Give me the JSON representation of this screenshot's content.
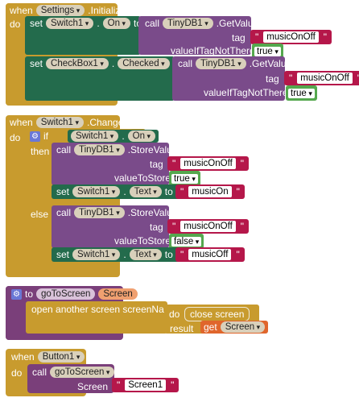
{
  "block1": {
    "when": "when",
    "component": "Settings",
    "event": ".Initialize",
    "do": "do",
    "set1": {
      "set": "set",
      "component": "Switch1",
      "dot": ".",
      "prop": "On",
      "to": "to",
      "call": "call",
      "db": "TinyDB1",
      "method": ".GetValue",
      "tag": "tag",
      "tag_value": "musicOnOff",
      "vitn": "valueIfTagNotThere",
      "default": "true"
    },
    "set2": {
      "set": "set",
      "component": "CheckBox1",
      "dot": ".",
      "prop": "Checked",
      "to": "to",
      "call": "call",
      "db": "TinyDB1",
      "method": ".GetValue",
      "tag": "tag",
      "tag_value": "musicOnOff",
      "vitn": "valueIfTagNotThere",
      "default": "true"
    }
  },
  "block2": {
    "when": "when",
    "component": "Switch1",
    "event": ".Changed",
    "do": "do",
    "if": "if",
    "cond_component": "Switch1",
    "cond_dot": ".",
    "cond_prop": "On",
    "then": "then",
    "else": "else",
    "then_call": {
      "call": "call",
      "db": "TinyDB1",
      "method": ".StoreValue",
      "tag": "tag",
      "tag_value": "musicOnOff",
      "vts": "valueToStore",
      "value": "true"
    },
    "then_set": {
      "set": "set",
      "component": "Switch1",
      "dot": ".",
      "prop": "Text",
      "to": "to",
      "value": "musicOn"
    },
    "else_call": {
      "call": "call",
      "db": "TinyDB1",
      "method": ".StoreValue",
      "tag": "tag",
      "tag_value": "musicOnOff",
      "vts": "valueToStore",
      "value": "false"
    },
    "else_set": {
      "set": "set",
      "component": "Switch1",
      "dot": ".",
      "prop": "Text",
      "to": "to",
      "value": "musicOff"
    }
  },
  "block3": {
    "to": "to",
    "name": "goToScreen",
    "param": "Screen",
    "open": "open another screen  screenName",
    "do": "do",
    "close": "close screen",
    "result": "result",
    "get": "get",
    "get_var": "Screen"
  },
  "block4": {
    "when": "when",
    "component": "Button1",
    "event": ".Click",
    "do": "do",
    "call": "call",
    "proc": "goToScreen",
    "arg": "Screen",
    "arg_value": "Screen1"
  }
}
